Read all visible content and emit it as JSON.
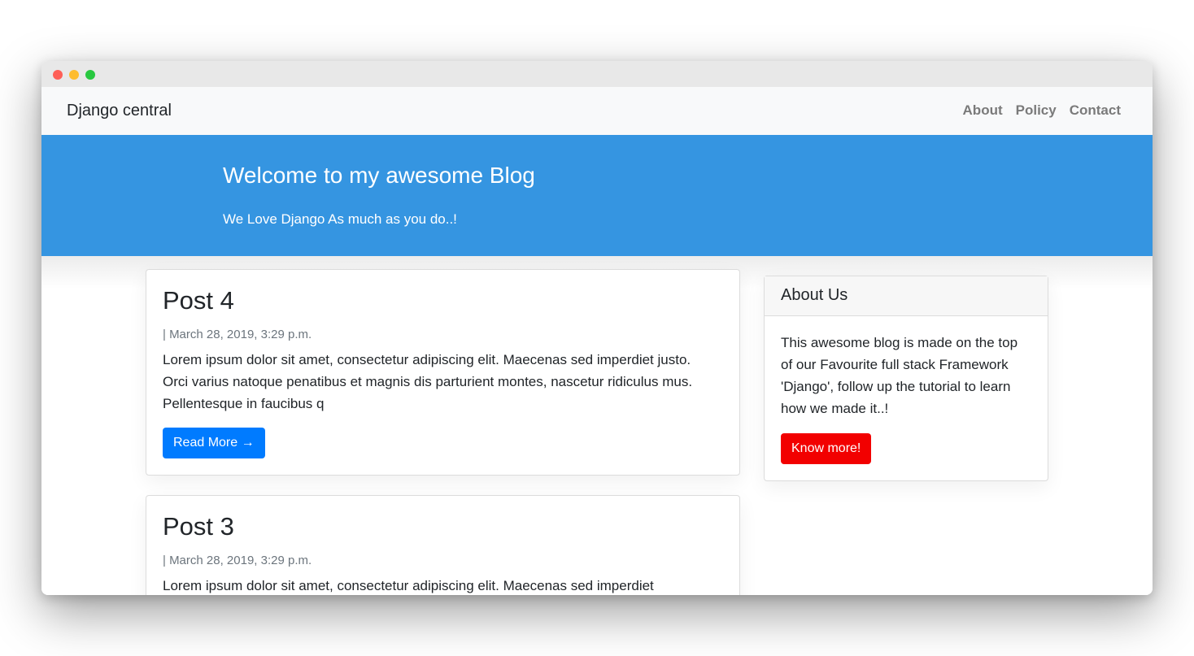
{
  "window": {
    "controls": [
      "close",
      "minimize",
      "maximize"
    ]
  },
  "navbar": {
    "brand": "Django central",
    "links": [
      {
        "label": "About"
      },
      {
        "label": "Policy"
      },
      {
        "label": "Contact"
      }
    ]
  },
  "masthead": {
    "title": "Welcome to my awesome Blog",
    "subtitle": "We Love Django As much as you do..!",
    "background": "#3595e1"
  },
  "posts": [
    {
      "title": "Post 4",
      "meta": "| March 28, 2019, 3:29 p.m.",
      "excerpt": "Lorem ipsum dolor sit amet, consectetur adipiscing elit. Maecenas sed imperdiet justo. Orci varius natoque penatibus et magnis dis parturient montes, nascetur ridiculus mus. Pellentesque in faucibus q",
      "button_label": "Read More →"
    },
    {
      "title": "Post 3",
      "meta": "| March 28, 2019, 3:29 p.m.",
      "excerpt": "Lorem ipsum dolor sit amet, consectetur adipiscing elit. Maecenas sed imperdiet"
    }
  ],
  "sidebar": {
    "title": "About Us",
    "body": "This awesome blog is made on the top of our Favourite full stack Framework 'Django', follow up the tutorial to learn how we made it..!",
    "button_label": "Know more!"
  },
  "colors": {
    "primary": "#007bff",
    "danger": "#f20000",
    "navbar_bg": "#f8f9fa"
  }
}
